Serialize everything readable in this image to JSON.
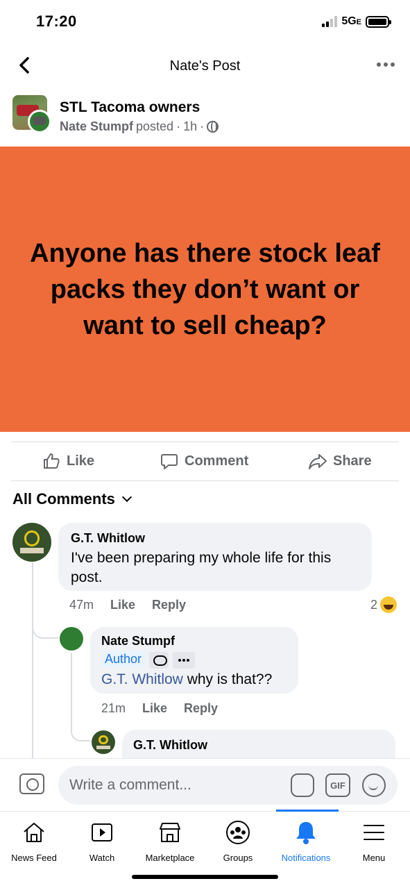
{
  "status_bar": {
    "time": "17:20",
    "network": "5G",
    "network_suffix": "E"
  },
  "header": {
    "title": "Nate's Post"
  },
  "post": {
    "group_name": "STL Tacoma owners",
    "author": "Nate Stumpf",
    "posted_word": "posted",
    "time": "1h",
    "card_text": "Anyone has there stock leaf packs they don’t want or want to sell cheap?",
    "card_color": "#ee6c3a"
  },
  "actions": {
    "like": "Like",
    "comment": "Comment",
    "share": "Share"
  },
  "comments_filter": "All Comments",
  "comments": [
    {
      "name": "G.T. Whitlow",
      "text": "I've been preparing my whole life for this post.",
      "time": "47m",
      "like": "Like",
      "reply": "Reply",
      "reaction_count": "2"
    },
    {
      "name": "Nate Stumpf",
      "tag": "Author",
      "mention": "G.T. Whitlow",
      "text": " why is that??",
      "time": "21m",
      "like": "Like",
      "reply": "Reply"
    },
    {
      "name": "G.T. Whitlow"
    }
  ],
  "composer": {
    "placeholder": "Write a comment...",
    "gif_label": "GIF"
  },
  "tabs": [
    {
      "label": "News Feed",
      "icon": "home-icon"
    },
    {
      "label": "Watch",
      "icon": "watch-icon"
    },
    {
      "label": "Marketplace",
      "icon": "marketplace-icon"
    },
    {
      "label": "Groups",
      "icon": "groups-icon"
    },
    {
      "label": "Notifications",
      "icon": "bell-icon",
      "active": true
    },
    {
      "label": "Menu",
      "icon": "menu-icon"
    }
  ],
  "colors": {
    "accent": "#1877f2",
    "mention": "#385898",
    "card": "#ee6c3a"
  }
}
